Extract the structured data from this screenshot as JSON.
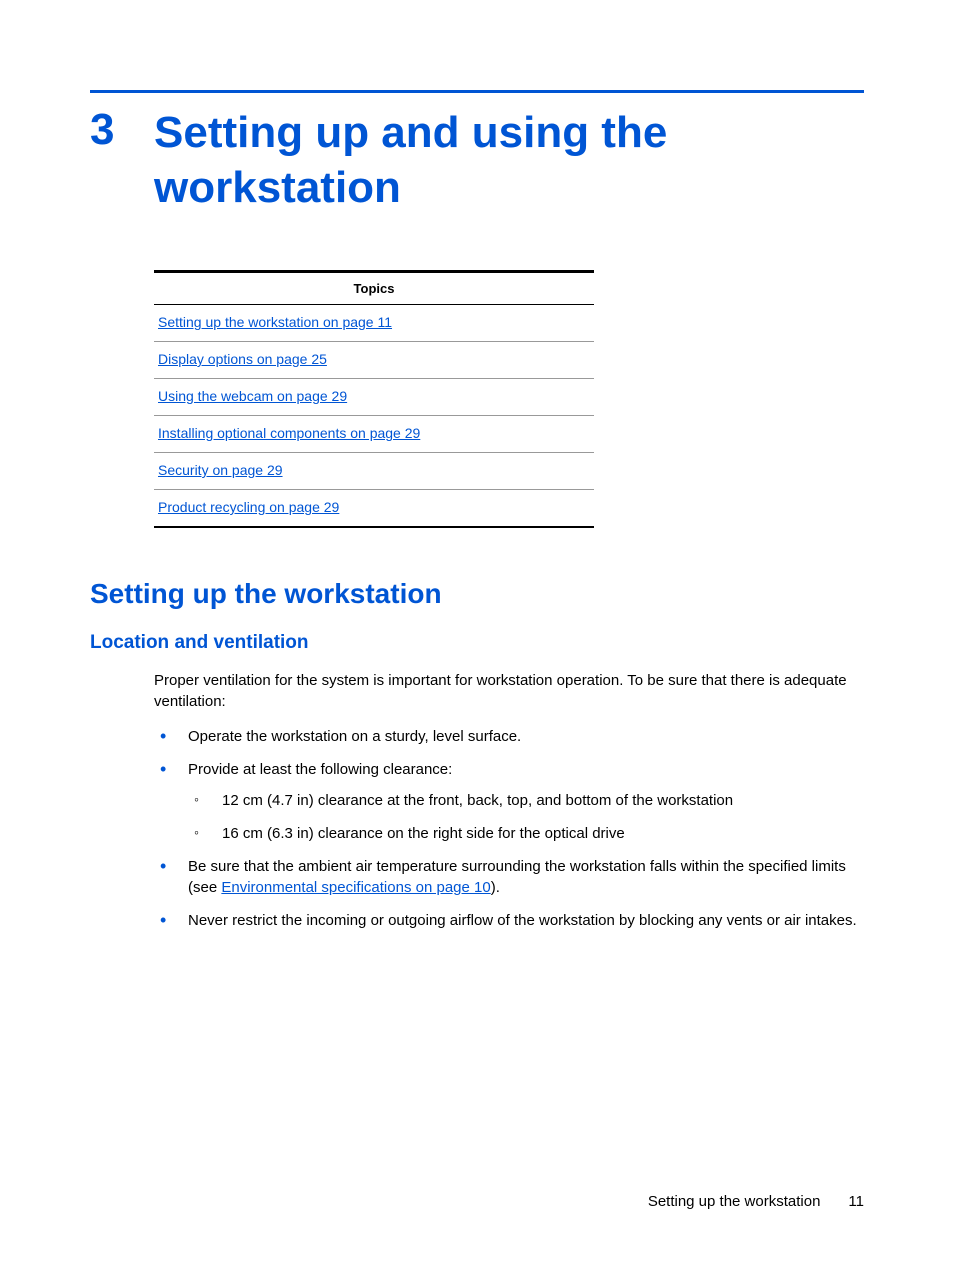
{
  "chapter": {
    "number": "3",
    "title": "Setting up and using the workstation"
  },
  "topicsHeader": "Topics",
  "topics": [
    {
      "label": "Setting up the workstation on page 11"
    },
    {
      "label": "Display options on page 25"
    },
    {
      "label": "Using the webcam on page 29"
    },
    {
      "label": "Installing optional components on page 29"
    },
    {
      "label": "Security on page 29"
    },
    {
      "label": "Product recycling on page 29"
    }
  ],
  "section": {
    "h2": "Setting up the workstation",
    "h3": "Location and ventilation",
    "intro": "Proper ventilation for the system is important for workstation operation. To be sure that there is adequate ventilation:",
    "bullets": {
      "b1": "Operate the workstation on a sturdy, level surface.",
      "b2": "Provide at least the following clearance:",
      "b2sub1": "12 cm (4.7 in) clearance at the front, back, top, and bottom of the workstation",
      "b2sub2": "16 cm (6.3 in) clearance on the right side for the optical drive",
      "b3pre": "Be sure that the ambient air temperature surrounding the workstation falls within the specified limits (see ",
      "b3link": "Environmental specifications on page 10",
      "b3post": ").",
      "b4": "Never restrict the incoming or outgoing airflow of the workstation by blocking any vents or air intakes."
    }
  },
  "footer": {
    "section": "Setting up the workstation",
    "page": "11"
  }
}
